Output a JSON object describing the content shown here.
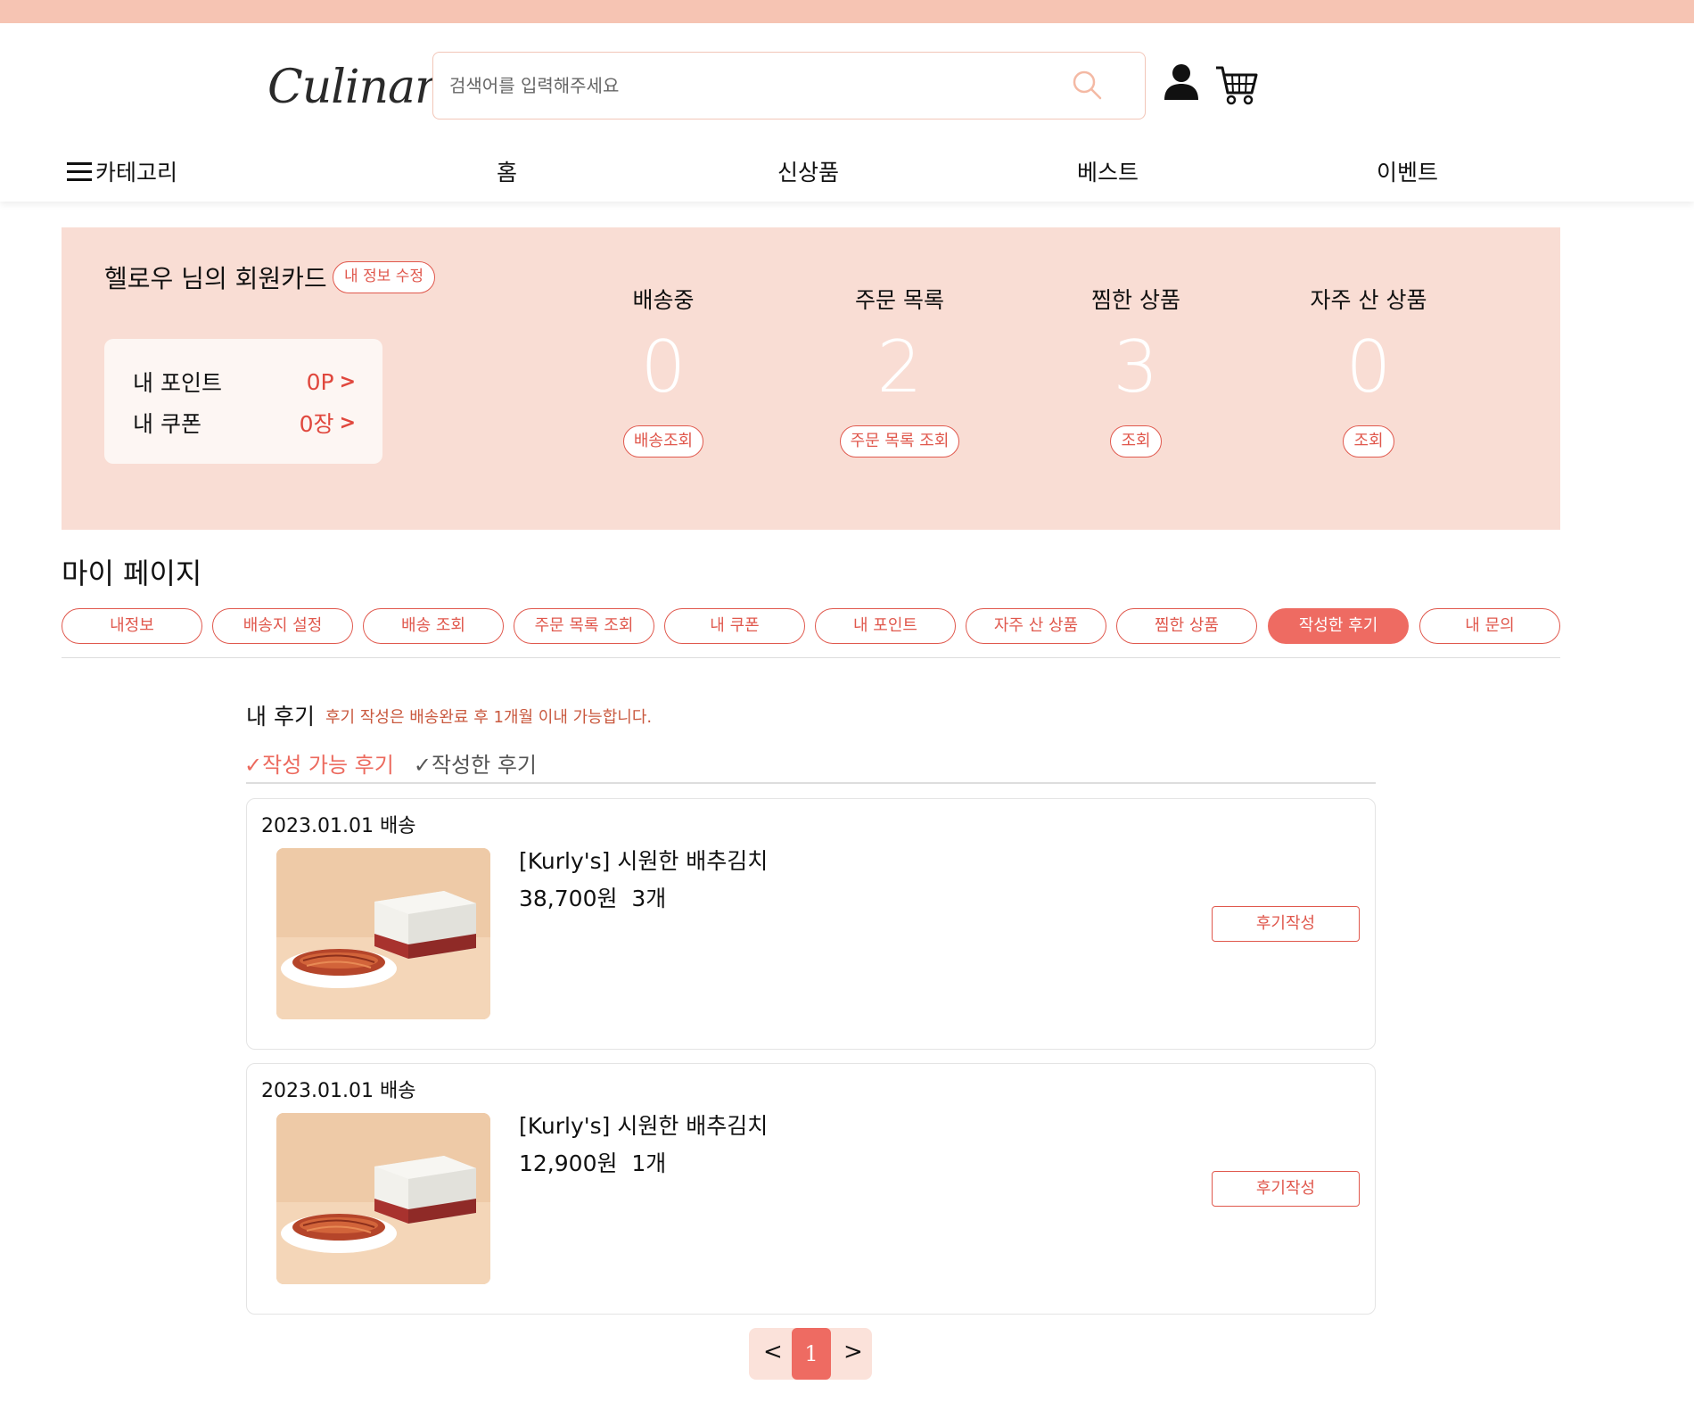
{
  "brand": {
    "logo_text": "Culinari"
  },
  "search": {
    "placeholder": "검색어를 입력해주세요"
  },
  "nav": {
    "category_label": "카테고리",
    "items": [
      "홈",
      "신상품",
      "베스트",
      "이벤트"
    ]
  },
  "member_card": {
    "title": "헬로우 님의 회원카드",
    "edit_label": "내 정보 수정",
    "points_label": "내 포인트",
    "points_value": "0P",
    "coupons_label": "내 쿠폰",
    "coupons_value": "0장",
    "chevron": ">",
    "stats": [
      {
        "label": "배송중",
        "value": "0",
        "button": "배송조회"
      },
      {
        "label": "주문 목록",
        "value": "2",
        "button": "주문 목록 조회"
      },
      {
        "label": "찜한 상품",
        "value": "3",
        "button": "조회"
      },
      {
        "label": "자주 산 상품",
        "value": "0",
        "button": "조회"
      }
    ]
  },
  "mypage": {
    "title": "마이 페이지",
    "tabs": [
      "내정보",
      "배송지 설정",
      "배송 조회",
      "주문 목록 조회",
      "내 쿠폰",
      "내 포인트",
      "자주 산 상품",
      "찜한 상품",
      "작성한 후기",
      "내 문의"
    ],
    "active_tab": "작성한 후기"
  },
  "reviews": {
    "title": "내 후기",
    "note": "후기 작성은 배송완료 후 1개월 이내 가능합니다.",
    "subtabs": [
      "✓작성 가능 후기",
      "✓작성한 후기"
    ],
    "items": [
      {
        "date": "2023.01.01 배송",
        "name": "[Kurly's] 시원한 배추김치",
        "price": "38,700원",
        "qty": "3개",
        "button": "후기작성"
      },
      {
        "date": "2023.01.01 배송",
        "name": "[Kurly's] 시원한 배추김치",
        "price": "12,900원",
        "qty": "1개",
        "button": "후기작성"
      }
    ]
  },
  "pagination": {
    "prev": "<",
    "current": "1",
    "next": ">"
  },
  "colors": {
    "accent": "#ee6b62",
    "accent_dark": "#e0584d",
    "member_bg": "#f9ddd4",
    "topbar": "#f6c4b3"
  }
}
